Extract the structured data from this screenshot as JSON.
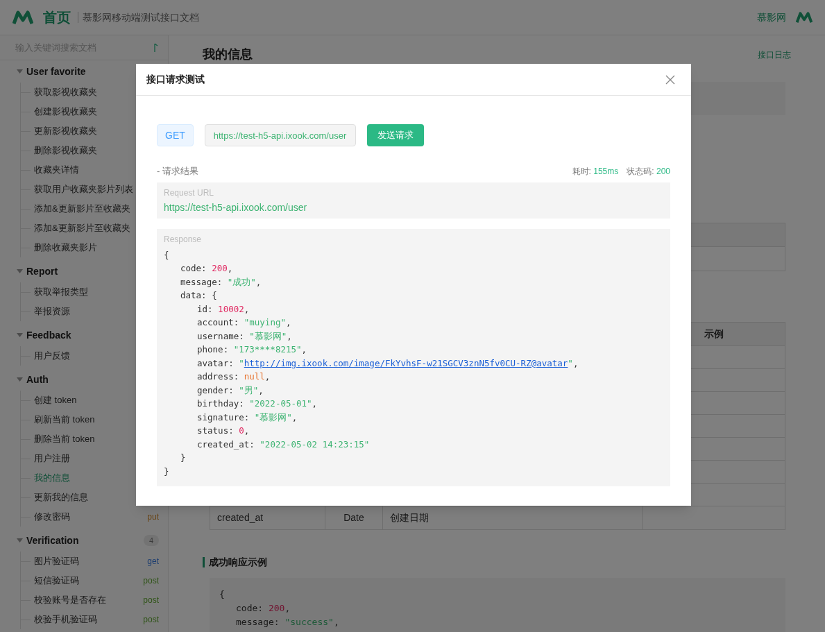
{
  "header": {
    "home": "首页",
    "subtitle": "慕影网移动端测试接口文档",
    "site": "慕影网"
  },
  "sidebar": {
    "search": {
      "placeholder": "输入关键词搜索文档"
    },
    "groups": [
      {
        "title": "User favorite",
        "expanded": true,
        "items": [
          {
            "label": "获取影视收藏夹",
            "selected": false
          },
          {
            "label": "创建影视收藏夹",
            "selected": false
          },
          {
            "label": "更新影视收藏夹",
            "selected": false
          },
          {
            "label": "删除影视收藏夹",
            "selected": false
          },
          {
            "label": "收藏夹详情",
            "selected": false
          },
          {
            "label": "获取用户收藏夹影片列表",
            "selected": false
          },
          {
            "label": "添加&更新影片至收藏夹",
            "selected": false
          },
          {
            "label": "添加&更新影片至收藏夹",
            "selected": false
          },
          {
            "label": "删除收藏夹影片",
            "selected": false
          }
        ]
      },
      {
        "title": "Report",
        "expanded": true,
        "items": [
          {
            "label": "获取举报类型",
            "selected": false
          },
          {
            "label": "举报资源",
            "selected": false
          }
        ]
      },
      {
        "title": "Feedback",
        "expanded": true,
        "items": [
          {
            "label": "用户反馈",
            "selected": false
          }
        ]
      },
      {
        "title": "Auth",
        "expanded": true,
        "items": [
          {
            "label": "创建 token",
            "selected": false
          },
          {
            "label": "刷新当前 token",
            "selected": false
          },
          {
            "label": "删除当前 token",
            "selected": false
          },
          {
            "label": "用户注册",
            "selected": false
          },
          {
            "label": "我的信息",
            "selected": true
          },
          {
            "label": "更新我的信息",
            "selected": false
          },
          {
            "label": "修改密码",
            "selected": false,
            "method": "put"
          }
        ]
      },
      {
        "title": "Verification",
        "expanded": true,
        "count": "4",
        "items": [
          {
            "label": "图片验证码",
            "selected": false,
            "method": "get"
          },
          {
            "label": "短信验证码",
            "selected": false,
            "method": "post"
          },
          {
            "label": "校验账号是否存在",
            "selected": false,
            "method": "post"
          },
          {
            "label": "校验手机验证码",
            "selected": false,
            "method": "post"
          }
        ]
      }
    ]
  },
  "main": {
    "title": "我的信息",
    "log_link": "接口日志",
    "table": {
      "column_4": "示例",
      "last_row": {
        "column_1": "created_at",
        "column_2": "Date",
        "column_3": "创建日期"
      }
    },
    "example": {
      "title": "成功响应示例",
      "open": "{",
      "fields": [
        {
          "key": "code:",
          "value": "200",
          "kind": "number",
          "sep": ","
        },
        {
          "key": "message:",
          "value": "\"success\"",
          "kind": "string",
          "sep": ","
        }
      ]
    }
  },
  "modal": {
    "title": "接口请求测试",
    "method": "GET",
    "url": "https://test-h5-api.ixook.com/user",
    "send": "发送请求",
    "result_label": "- 请求结果",
    "time_label": "耗时:",
    "time": "155ms",
    "status_label": "状态码:",
    "status": "200",
    "request_url_label": "Request URL",
    "request_url": "https://test-h5-api.ixook.com/user",
    "response_label": "Response",
    "response": {
      "open": "{",
      "close": "}",
      "fields": [
        {
          "key": "code:",
          "value": "200",
          "kind": "number",
          "sep": ","
        },
        {
          "key": "message:",
          "value": "\"成功\"",
          "kind": "string",
          "sep": ","
        },
        {
          "key": "data:",
          "kind": "object",
          "open": "{",
          "close": "}",
          "children": [
            {
              "key": "id:",
              "value": "10002",
              "kind": "number",
              "sep": ","
            },
            {
              "key": "account:",
              "value": "\"muying\"",
              "kind": "string",
              "sep": ","
            },
            {
              "key": "username:",
              "value": "\"慕影网\"",
              "kind": "string",
              "sep": ","
            },
            {
              "key": "phone:",
              "value": "\"173****8215\"",
              "kind": "string",
              "sep": ","
            },
            {
              "key": "avatar:",
              "value": "http://img.ixook.com/image/FkYvhsF-w21SGCV3znN5fv0CU-RZ@avatar",
              "quote": "\"",
              "kind": "link",
              "sep": ","
            },
            {
              "key": "address:",
              "value": "null",
              "kind": "null",
              "sep": ","
            },
            {
              "key": "gender:",
              "value": "\"男\"",
              "kind": "string",
              "sep": ","
            },
            {
              "key": "birthday:",
              "value": "\"2022-05-01\"",
              "kind": "string",
              "sep": ","
            },
            {
              "key": "signature:",
              "value": "\"慕影网\"",
              "kind": "string",
              "sep": ","
            },
            {
              "key": "status:",
              "value": "0",
              "kind": "number",
              "sep": ","
            },
            {
              "key": "created_at:",
              "value": "\"2022-05-02 14:23:15\"",
              "kind": "string"
            }
          ]
        }
      ]
    }
  }
}
